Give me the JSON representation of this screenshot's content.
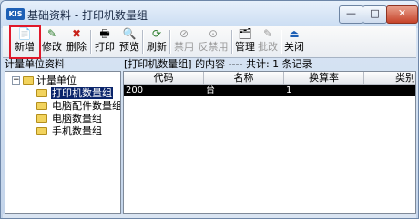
{
  "window": {
    "app_badge": "KIS",
    "title": "基础资料 - 打印机数量组",
    "min_glyph": "—",
    "max_glyph": "□",
    "close_glyph": "✕"
  },
  "toolbar": {
    "items": [
      {
        "label": "新增",
        "icon": "📄",
        "icon_name": "new-document-icon",
        "enabled": true
      },
      {
        "label": "修改",
        "icon": "✎",
        "icon_name": "edit-pencil-icon",
        "enabled": true
      },
      {
        "label": "删除",
        "icon": "✖",
        "icon_name": "delete-x-icon",
        "enabled": true
      },
      {
        "label": "打印",
        "icon": "🖶",
        "icon_name": "printer-icon",
        "enabled": true
      },
      {
        "label": "预览",
        "icon": "🔍",
        "icon_name": "preview-icon",
        "enabled": true
      },
      {
        "label": "刷新",
        "icon": "⟳",
        "icon_name": "refresh-icon",
        "enabled": true
      },
      {
        "label": "禁用",
        "icon": "⊘",
        "icon_name": "disable-icon",
        "enabled": false
      },
      {
        "label": "反禁用",
        "icon": "⊙",
        "icon_name": "enable-icon",
        "enabled": false
      },
      {
        "label": "管理",
        "icon": "🗂",
        "icon_name": "manage-icon",
        "enabled": true
      },
      {
        "label": "批改",
        "icon": "✎",
        "icon_name": "batch-edit-icon",
        "enabled": false
      },
      {
        "label": "关闭",
        "icon": "⏏",
        "icon_name": "close-door-icon",
        "enabled": true
      }
    ]
  },
  "left_pane": {
    "title": "计量单位资料",
    "root": "计量单位",
    "expander": "−",
    "children": [
      "打印机数量组",
      "电脑配件数量组",
      "电脑数量组",
      "手机数量组"
    ],
    "selected": "打印机数量组"
  },
  "right_pane": {
    "title": "[打印机数量组] 的内容 ---- 共计: 1 条记录",
    "columns": [
      "代码",
      "名称",
      "换算率",
      "类别"
    ],
    "rows": [
      [
        "200",
        "台",
        "1",
        ""
      ]
    ]
  },
  "colors": {
    "highlight_box": "#e0182a",
    "selection": "#0a246a",
    "title_bar": "#cadcf2"
  }
}
